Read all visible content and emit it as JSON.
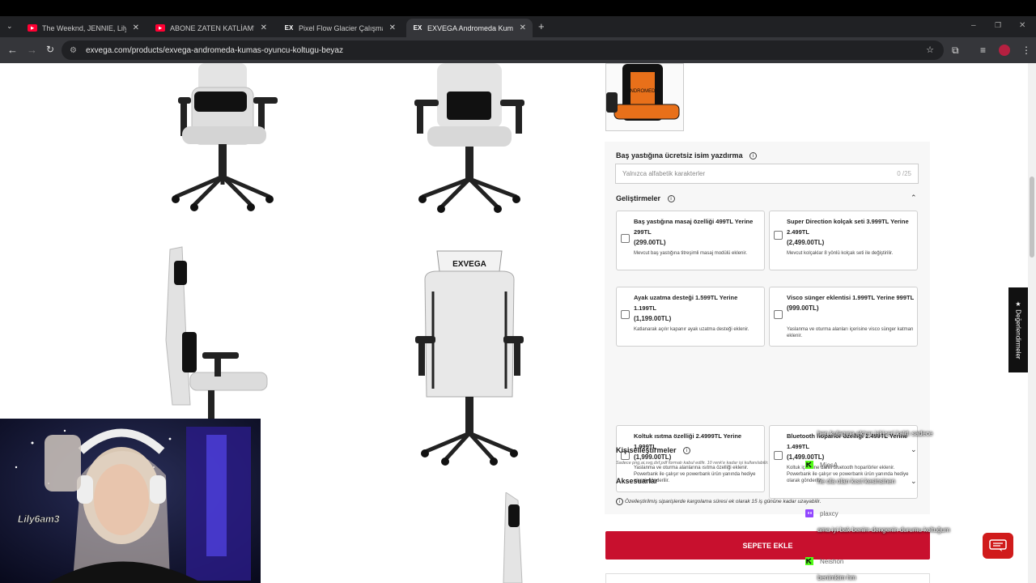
{
  "browser": {
    "tabs": [
      {
        "title": "The Weeknd, JENNIE, Lily-Rose",
        "favicon": "youtube-icon",
        "active": false
      },
      {
        "title": "ABONE ZATEN KATLİAM'LARIN",
        "favicon": "youtube-icon",
        "active": false
      },
      {
        "title": "Pixel Flow Glacier Çalışma Koltu",
        "favicon": "exvega-icon",
        "active": false
      },
      {
        "title": "EXVEGA Andromeda Kumaş Oy",
        "favicon": "exvega-icon",
        "active": true
      }
    ],
    "favicon_text": "EX",
    "youtube_text": "▶",
    "url": "exvega.com/products/exvega-andromeda-kumas-oyuncu-koltugu-beyaz",
    "new_tab": "+",
    "close": "✕"
  },
  "product": {
    "chair_back_logo": "EXVEGA",
    "thumb_logo": "ANDROMEDA",
    "name_print": {
      "title": "Baş yastığına ücretsiz isim yazdırma",
      "info": "i",
      "placeholder": "Yalnızca alfabetik karakterler",
      "counter": "0 /25"
    },
    "upgrades": {
      "title": "Geliştirmeler",
      "info": "i",
      "chevron": "⌃",
      "options": [
        {
          "title": "Baş yastığına masaj özelliği 499TL Yerine 299TL",
          "price": "(299.00TL)",
          "desc": "Mevcut baş yastığına titreşimli masaj modülü eklenir.",
          "checked": false
        },
        {
          "title": "Super Direction kolçak seti 3.999TL Yerine 2.499TL",
          "price": "(2,499.00TL)",
          "desc": "Mevcut kolçaklar 8 yönlü kolçak seti ile değiştirilir.",
          "checked": false
        },
        {
          "title": "Ayak uzatma desteği 1.599TL Yerine 1.199TL",
          "price": "(1,199.00TL)",
          "desc": "Katlanarak açılır kapanır ayak uzatma desteği eklenir.",
          "checked": false
        },
        {
          "title": "Visco sünger eklentisi 1.999TL Yerine 999TL",
          "price": "(999.00TL)",
          "desc": "Yaslanma ve oturma alanları içerisine visco sünger katman eklenir.",
          "checked": false
        },
        {
          "title": "Koltuk ısıtma özelliği 2.4999TL Yerine 1.999TL",
          "price": "(1,999.00TL)",
          "desc": "Yaslanma ve oturma alanlarına ısıtma özelliği eklenir. Powerbank ile çalışır ve powerbank ürün yanında hediye olarak gönderilir.",
          "checked": false
        },
        {
          "title": "Bluetooth hoparlör özelliği 2.499TL Yerine 1.499TL",
          "price": "(1,499.00TL)",
          "desc": "Koltuk içerisine dahili bluetooth hoparlörler eklenir. Powerbank ile çalışır ve powerbank ürün yanında hediye olarak gönderilir.",
          "checked": false
        }
      ]
    },
    "personalization": {
      "title": "Kişiselleştirmeler",
      "info": "i",
      "chevron": "⌄",
      "note": "Sadece png,ai,svg,dxf,pdf formatı kabul edilir. 10 renk'e kadar işi kullanılabilir."
    },
    "accessories": {
      "title": "Aksesuarlar",
      "chevron": "⌄"
    },
    "shipping_note": "Özelleştirilmiş siparişlerde kargolama süresi ek olarak 15 iş gününe kadar uzayabilir.",
    "add_to_cart": "SEPETE EKLE",
    "reviews_tab": "★ Değerlendirmeler"
  },
  "stream_overlay": {
    "messages": [
      "ben kulaqına ektrar iskiçeri kaldı sadece",
      "ne ola olan kısıt kesinsinen",
      "ama iyi bak benim dengenin durumu koltuğum",
      "benimkim hm"
    ],
    "users": [
      {
        "name": "MjesA",
        "badge": "kick"
      },
      {
        "name": "plaxcy",
        "badge": "twitch"
      },
      {
        "name": "Neishon",
        "badge": "kick"
      }
    ],
    "cam_tag": "Lily6am3"
  },
  "colors": {
    "accent": "#c8102e",
    "kick": "#53fc18",
    "twitch": "#9146ff"
  }
}
